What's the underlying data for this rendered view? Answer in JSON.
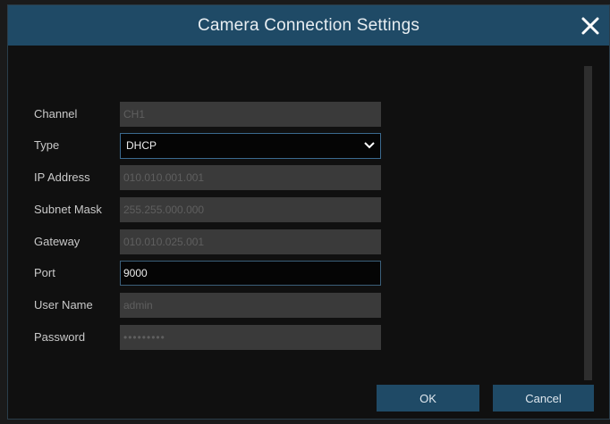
{
  "dialog": {
    "title": "Camera Connection Settings",
    "close_icon": "close-icon"
  },
  "form": {
    "channel": {
      "label": "Channel",
      "value": "CH1"
    },
    "type": {
      "label": "Type",
      "value": "DHCP",
      "icon": "chevron-down-icon"
    },
    "ip_address": {
      "label": "IP Address",
      "value": "010.010.001.001"
    },
    "subnet_mask": {
      "label": "Subnet Mask",
      "value": "255.255.000.000"
    },
    "gateway": {
      "label": "Gateway",
      "value": "010.010.025.001"
    },
    "port": {
      "label": "Port",
      "value": "9000"
    },
    "user_name": {
      "label": "User Name",
      "value": "admin"
    },
    "password": {
      "label": "Password",
      "value": "•••••••••"
    }
  },
  "buttons": {
    "ok_label": "OK",
    "cancel_label": "Cancel"
  },
  "colors": {
    "title_bar": "#1f4a66",
    "button": "#1f4a66",
    "active_field_border": "#3b6a8f",
    "disabled_field": "#3a3a3a"
  }
}
